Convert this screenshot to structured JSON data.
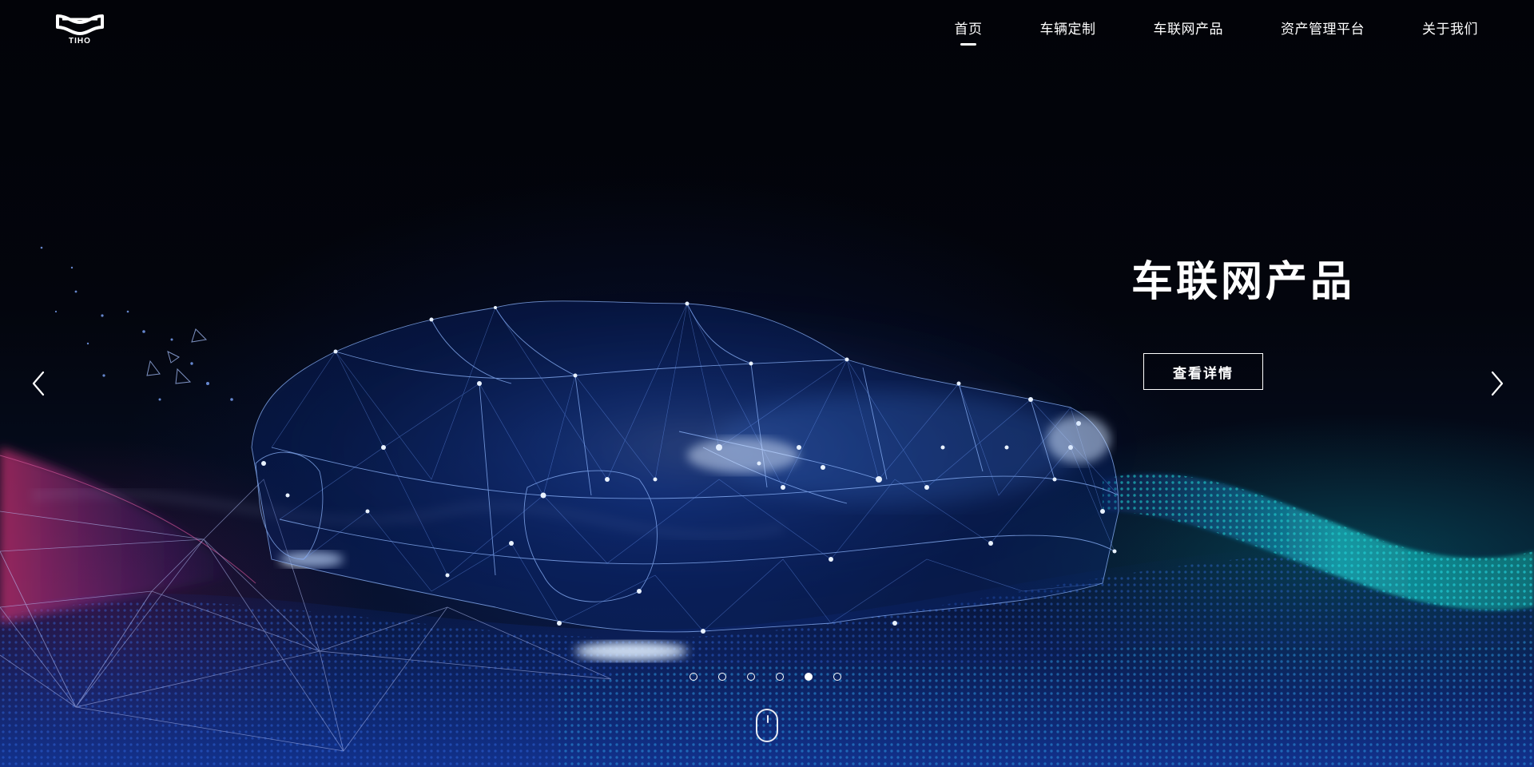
{
  "brand": {
    "logo_text": "TIHO"
  },
  "nav": {
    "items": [
      {
        "label": "首页",
        "active": true
      },
      {
        "label": "车辆定制",
        "active": false
      },
      {
        "label": "车联网产品",
        "active": false
      },
      {
        "label": "资产管理平台",
        "active": false
      },
      {
        "label": "关于我们",
        "active": false
      }
    ]
  },
  "hero": {
    "title": "车联网产品",
    "button_label": "查看详情",
    "background_image": "wireframe-car-network"
  },
  "carousel": {
    "slide_count": 6,
    "active_slide": 5,
    "prev_icon": "chevron-left-icon",
    "next_icon": "chevron-right-icon"
  },
  "scroll_hint": {
    "icon": "mouse-scroll-icon"
  },
  "colors": {
    "background": "#02040a",
    "text": "#ffffff",
    "accent_blue": "#2a6dff",
    "accent_teal": "#14b8b0",
    "accent_magenta": "#a0266e"
  }
}
